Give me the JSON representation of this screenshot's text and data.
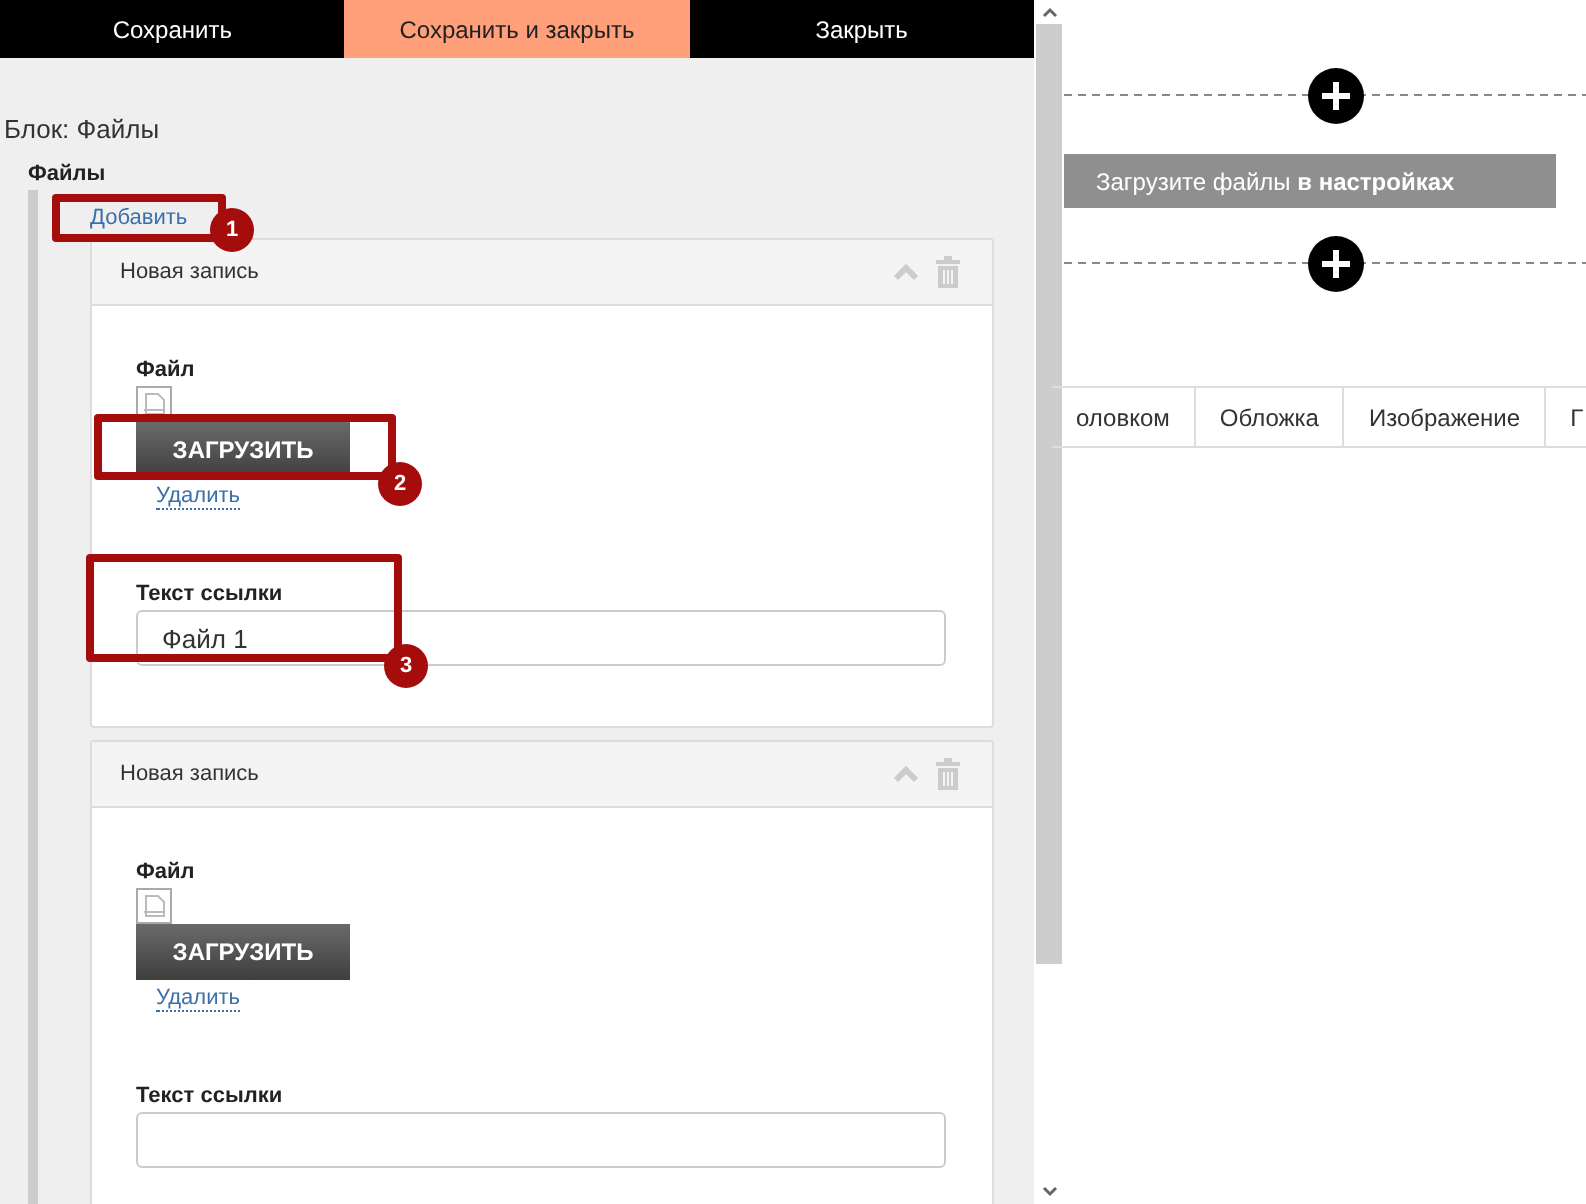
{
  "toolbar": [
    {
      "label": "Сохранить",
      "selected": false
    },
    {
      "label": "Сохранить и закрыть",
      "selected": true
    },
    {
      "label": "Закрыть",
      "selected": false
    }
  ],
  "block_title": "Блок: Файлы",
  "field_label": "Файлы",
  "add_link": "Добавить",
  "entries": [
    {
      "header": "Новая запись",
      "file_label": "Файл",
      "upload_button": "ЗАГРУЗИТЬ",
      "delete_link": "Удалить",
      "link_text_label": "Текст ссылки",
      "link_text_value": "Файл 1"
    },
    {
      "header": "Новая запись",
      "file_label": "Файл",
      "upload_button": "ЗАГРУЗИТЬ",
      "delete_link": "Удалить",
      "link_text_label": "Текст ссылки"
    }
  ],
  "annotations": [
    "1",
    "2",
    "3"
  ],
  "preview": {
    "notice": "Загрузите файлы **в настройках**",
    "tabs": [
      "оловком",
      "Обложка",
      "Изображение",
      "Г"
    ]
  }
}
